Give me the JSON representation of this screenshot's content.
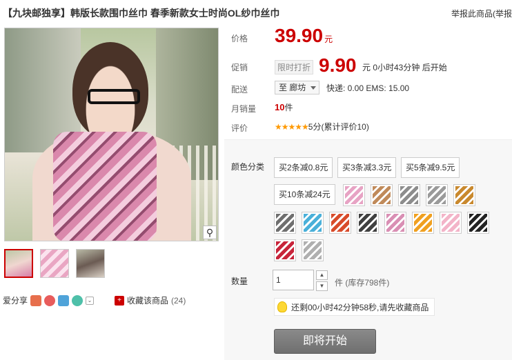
{
  "title": "【九块邮独享】韩版长款围巾丝巾 春季新款女士时尚OL纱巾丝巾",
  "report_link": "举报此商品(举报",
  "price": {
    "label": "价格",
    "value": "39.90",
    "unit": "元"
  },
  "promo": {
    "label": "促销",
    "tag": "限时打折",
    "value": "9.90",
    "unit_text": "元 0小时43分钟 后开始"
  },
  "delivery": {
    "label": "配送",
    "location": "至 廊坊",
    "shipping": "快递: 0.00 EMS: 15.00"
  },
  "monthly_sales": {
    "label": "月销量",
    "count": "10",
    "unit": "件"
  },
  "rating": {
    "label": "评价",
    "stars": "★★★★★",
    "text": "5分(累计评价10)"
  },
  "sku": {
    "label": "颜色分类",
    "options": [
      "买2条减0.8元",
      "买3条减3.3元",
      "买5条减9.5元",
      "买10条减24元"
    ],
    "swatch_colors": [
      "#e7a3c4",
      "#c08a5a",
      "#8d8d8d",
      "#9a9a9a",
      "#c9892e",
      "#6f6f6f",
      "#4ab0d9",
      "#d84b2a",
      "#404040",
      "#d98fb4",
      "#f0a020",
      "#f3b4c8",
      "#222222",
      "#c8243a",
      "#b0b0b0"
    ]
  },
  "quantity": {
    "label": "数量",
    "value": "1",
    "stock": "件 (库存798件)"
  },
  "tip": "还剩00小时42分钟58秒,请先收藏商品",
  "buy_button": "即将开始",
  "share": {
    "label": "爱分享",
    "favorite": "收藏该商品",
    "favorite_count": "(24)"
  }
}
